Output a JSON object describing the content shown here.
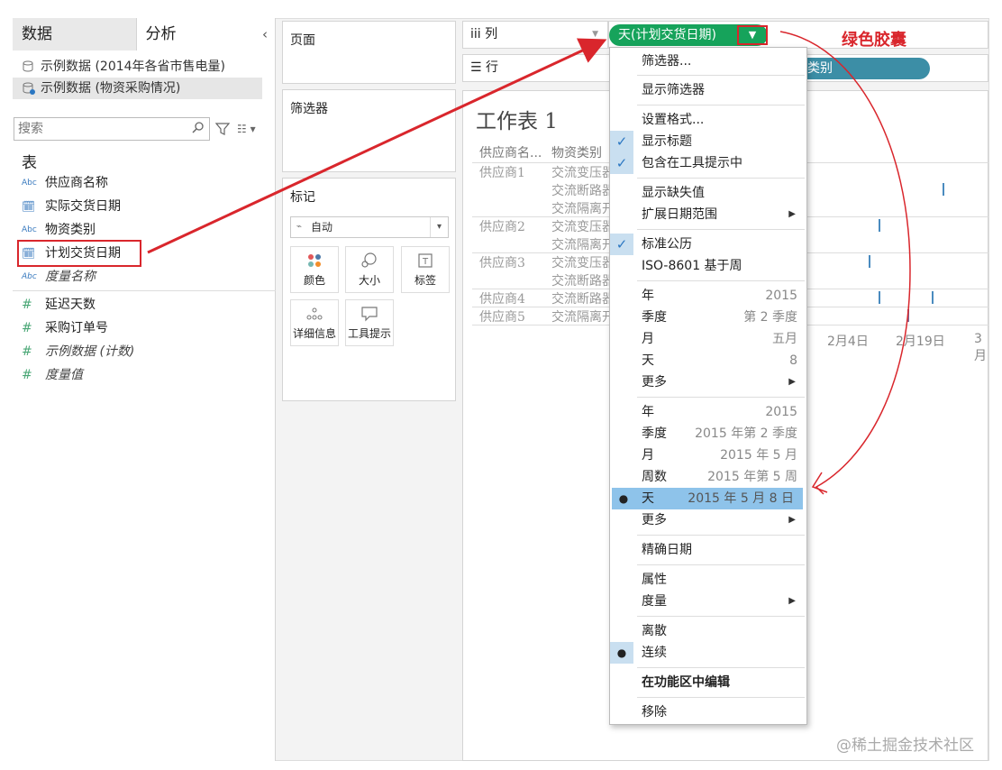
{
  "left_pane": {
    "tab_data": "数据",
    "tab_analysis": "分析",
    "collapse_glyph": "‹",
    "datasources": [
      "示例数据 (2014年各省市售电量)",
      "示例数据 (物资采购情况)"
    ],
    "search_placeholder": "搜索",
    "section_title": "表",
    "fields": [
      {
        "type": "Abc",
        "name": "供应商名称"
      },
      {
        "type": "cal",
        "name": "实际交货日期"
      },
      {
        "type": "Abc",
        "name": "物资类别"
      },
      {
        "type": "cal",
        "name": "计划交货日期"
      },
      {
        "type": "Abc",
        "name": "度量名称"
      },
      {
        "type": "num",
        "name": "延迟天数"
      },
      {
        "type": "num",
        "name": "采购订单号"
      },
      {
        "type": "num",
        "name": "示例数据 (计数)"
      },
      {
        "type": "num",
        "name": "度量值"
      }
    ]
  },
  "middle": {
    "pages_title": "页面",
    "filters_title": "筛选器",
    "marks_title": "标记",
    "marks_type": "自动",
    "mark_buttons": [
      "颜色",
      "大小",
      "标签",
      "详细信息",
      "工具提示"
    ]
  },
  "shelves": {
    "columns_label": "列",
    "rows_label": "行",
    "column_pill": "天(计划交货日期)",
    "row_pill": "类别",
    "annotation": "绿色胶囊"
  },
  "sheet": {
    "title": "工作表 1",
    "headers": [
      "供应商名...",
      "物资类别"
    ],
    "rows": [
      {
        "supplier": "供应商1",
        "items": [
          "交流变压器",
          "交流断路器",
          "交流隔离开"
        ]
      },
      {
        "supplier": "供应商2",
        "items": [
          "交流变压器",
          "交流隔离开"
        ]
      },
      {
        "supplier": "供应商3",
        "items": [
          "交流变压器",
          "交流断路器"
        ]
      },
      {
        "supplier": "供应商4",
        "items": [
          "交流断路器"
        ]
      },
      {
        "supplier": "供应商5",
        "items": [
          "交流隔离开"
        ]
      }
    ],
    "axis_labels": [
      "2月4日",
      "2月19日",
      "3月"
    ]
  },
  "menu": {
    "items": [
      {
        "label": "筛选器..."
      },
      {
        "label": "显示筛选器"
      },
      {
        "label": "设置格式..."
      },
      {
        "label": "显示标题",
        "checked": true
      },
      {
        "label": "包含在工具提示中",
        "checked": true
      },
      {
        "label": "显示缺失值"
      },
      {
        "label": "扩展日期范围",
        "submenu": true
      },
      {
        "label": "标准公历",
        "checked": true
      },
      {
        "label": "ISO-8601 基于周"
      },
      {
        "label": "年",
        "value": "2015"
      },
      {
        "label": "季度",
        "value": "第 2 季度"
      },
      {
        "label": "月",
        "value": "五月"
      },
      {
        "label": "天",
        "value": "8"
      },
      {
        "label": "更多",
        "submenu": true
      },
      {
        "label": "年",
        "value": "2015"
      },
      {
        "label": "季度",
        "value": "2015 年第 2 季度"
      },
      {
        "label": "月",
        "value": "2015 年 5 月"
      },
      {
        "label": "周数",
        "value": "2015 年第 5 周"
      },
      {
        "label": "天",
        "value": "2015 年 5 月 8 日",
        "selected": true
      },
      {
        "label": "更多",
        "submenu": true
      },
      {
        "label": "精确日期"
      },
      {
        "label": "属性"
      },
      {
        "label": "度量",
        "submenu": true
      },
      {
        "label": "离散"
      },
      {
        "label": "连续",
        "selected_dot": true
      },
      {
        "label": "在功能区中编辑",
        "bold": true
      },
      {
        "label": "移除"
      }
    ]
  },
  "watermark": "@稀土掘金技术社区",
  "colors": {
    "green_pill": "#16a35b",
    "teal_pill": "#3c8ea6",
    "annotation_red": "#d9262c",
    "menu_highlight": "#8ec3ea"
  }
}
